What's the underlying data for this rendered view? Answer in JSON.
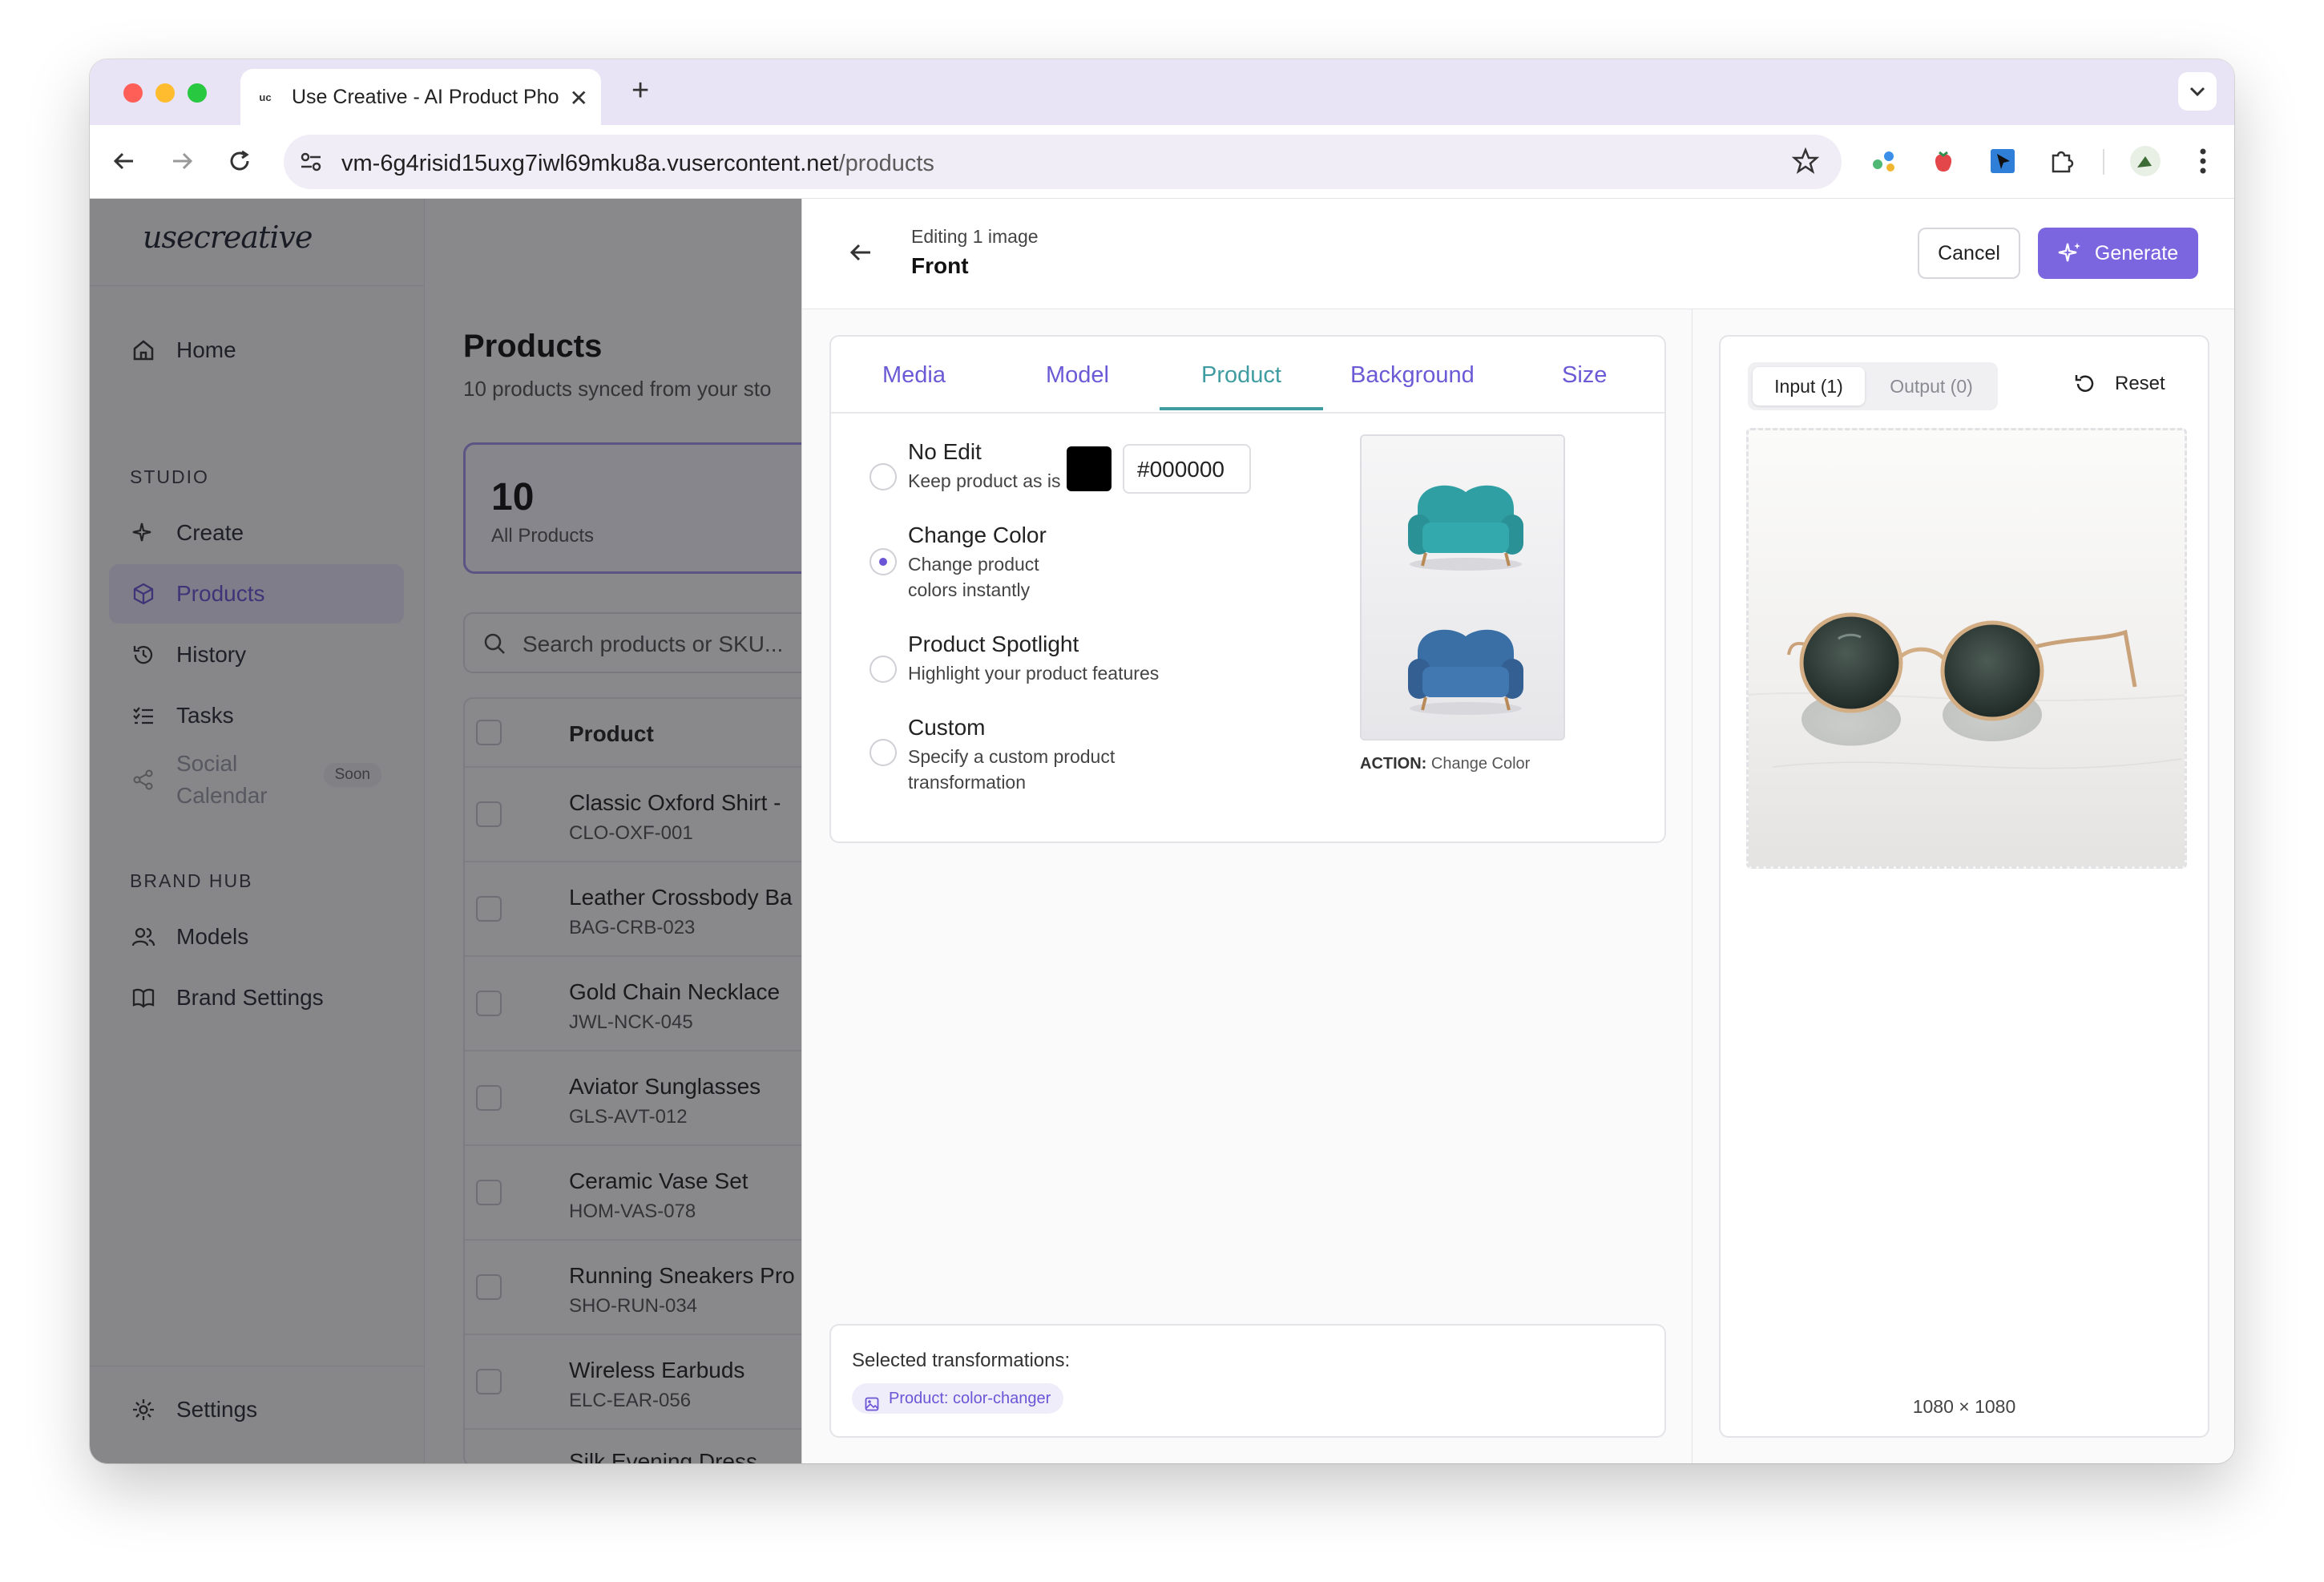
{
  "browser": {
    "tab_title": "Use Creative - AI Product Pho",
    "tab_favicon": "uc",
    "url_host": "vm-6g4risid15uxg7iwl69mku8a.vusercontent.net",
    "url_path": "/products"
  },
  "sidebar": {
    "logo": "usecreative",
    "sections": {
      "studio": "STUDIO",
      "brand_hub": "BRAND HUB"
    },
    "items": [
      {
        "label": "Home",
        "icon": "home-icon"
      },
      {
        "label": "Create",
        "icon": "sparkle-icon"
      },
      {
        "label": "Products",
        "icon": "box-icon",
        "active": true
      },
      {
        "label": "History",
        "icon": "history-icon"
      },
      {
        "label": "Tasks",
        "icon": "tasks-icon"
      },
      {
        "label": "Social Calendar",
        "icon": "share-icon",
        "badge": "Soon",
        "disabled": true
      },
      {
        "label": "Models",
        "icon": "users-icon"
      },
      {
        "label": "Brand Settings",
        "icon": "book-icon"
      }
    ],
    "settings_label": "Settings"
  },
  "products_page": {
    "title": "Products",
    "subtitle": "10 products synced from your sto",
    "stat": {
      "value": "10",
      "label": "All Products"
    },
    "search_placeholder": "Search products or SKU...",
    "column_product": "Product",
    "rows": [
      {
        "name": "Classic Oxford Shirt -",
        "sku": "CLO-OXF-001"
      },
      {
        "name": "Leather Crossbody Ba",
        "sku": "BAG-CRB-023"
      },
      {
        "name": "Gold Chain Necklace",
        "sku": "JWL-NCK-045"
      },
      {
        "name": "Aviator Sunglasses",
        "sku": "GLS-AVT-012"
      },
      {
        "name": "Ceramic Vase Set",
        "sku": "HOM-VAS-078"
      },
      {
        "name": "Running Sneakers Pro",
        "sku": "SHO-RUN-034"
      },
      {
        "name": "Wireless Earbuds",
        "sku": "ELC-EAR-056"
      },
      {
        "name": "Silk Evening Dress",
        "sku": ""
      }
    ]
  },
  "editor": {
    "subtitle": "Editing 1 image",
    "title": "Front",
    "cancel_label": "Cancel",
    "generate_label": "Generate",
    "tabs": [
      "Media",
      "Model",
      "Product",
      "Background",
      "Size"
    ],
    "active_tab": "Product",
    "options": [
      {
        "title": "No Edit",
        "desc": "Keep product as is",
        "selected": false
      },
      {
        "title": "Change Color",
        "desc": "Change product colors instantly",
        "selected": true
      },
      {
        "title": "Product Spotlight",
        "desc": "Highlight your product features",
        "selected": false
      },
      {
        "title": "Custom",
        "desc": "Specify a custom product transformation",
        "selected": false
      }
    ],
    "color_hex": "#000000",
    "swatch_color": "#000000",
    "action_prefix": "ACTION:",
    "action_value": "Change Color",
    "selected_label": "Selected transformations:",
    "chip_label": "Product: color-changer",
    "accent_color": "#7c66e0"
  },
  "image_panel": {
    "input_tab": "Input (1)",
    "output_tab": "Output (0)",
    "reset_label": "Reset",
    "dimensions": "1080 × 1080"
  }
}
